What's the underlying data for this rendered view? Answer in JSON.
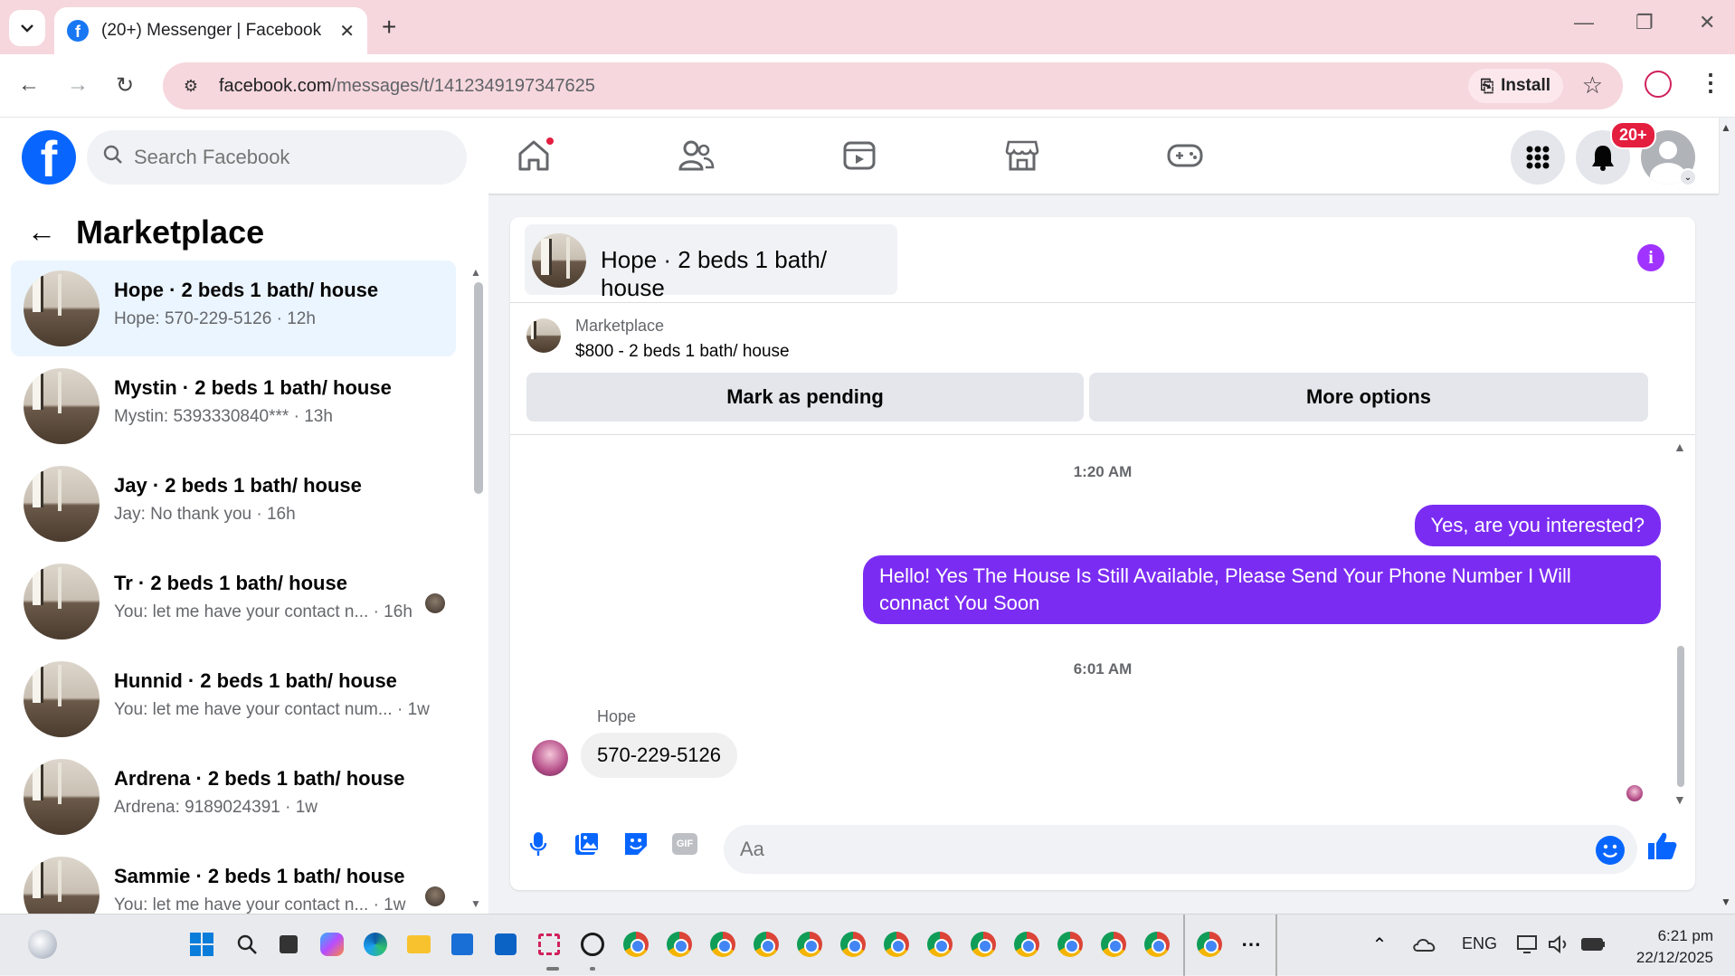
{
  "browser": {
    "tab_title": "(20+) Messenger | Facebook",
    "url_host": "facebook.com",
    "url_path": "/messages/t/1412349197347625",
    "install_label": "Install"
  },
  "fb": {
    "logo_letter": "f",
    "search_placeholder": "Search Facebook",
    "notif_badge": "20+"
  },
  "sidebar": {
    "title": "Marketplace",
    "conversations": [
      {
        "name": "Hope · 2 beds 1 bath/ house",
        "preview": "Hope: 570-229-5126 · 12h"
      },
      {
        "name": "Mystin · 2 beds 1 bath/ house",
        "preview": "Mystin: 5393330840*** · 13h"
      },
      {
        "name": "Jay · 2 beds 1 bath/ house",
        "preview": "Jay: No thank you · 16h"
      },
      {
        "name": "Tr · 2 beds 1 bath/ house",
        "preview": "You: let me have your contact n... · 16h"
      },
      {
        "name": "Hunnid · 2 beds 1 bath/ house",
        "preview": "You: let me have your contact num... · 1w"
      },
      {
        "name": "Ardrena · 2 beds 1 bath/ house",
        "preview": "Ardrena: 9189024391 · 1w"
      },
      {
        "name": "Sammie · 2 beds 1 bath/ house",
        "preview": "You: let me have your contact n... · 1w"
      }
    ]
  },
  "chat": {
    "header_name": "Hope · 2 beds 1 bath/ house",
    "listing_label": "Marketplace",
    "listing_price": "$800 - 2 beds 1 bath/ house",
    "btn_pending": "Mark as pending",
    "btn_more": "More options",
    "timestamp1": "1:20 AM",
    "msg_out1": "Yes, are you interested?",
    "msg_out2": "Hello! Yes The House  Is Still Available, Please Send Your Phone Number I Will connact You Soon",
    "timestamp2": "6:01 AM",
    "sender": "Hope",
    "msg_in1": "570-229-5126",
    "composer_placeholder": "Aa",
    "gif_label": "GIF"
  },
  "taskbar": {
    "lang": "ENG",
    "time": "6:21 pm",
    "date": "22/12/2025"
  },
  "colors": {
    "fb_blue": "#0866ff",
    "bubble_out": "#7b2cf2",
    "selected_row": "#ebf5ff",
    "tab_pink": "#f6d7dd"
  }
}
